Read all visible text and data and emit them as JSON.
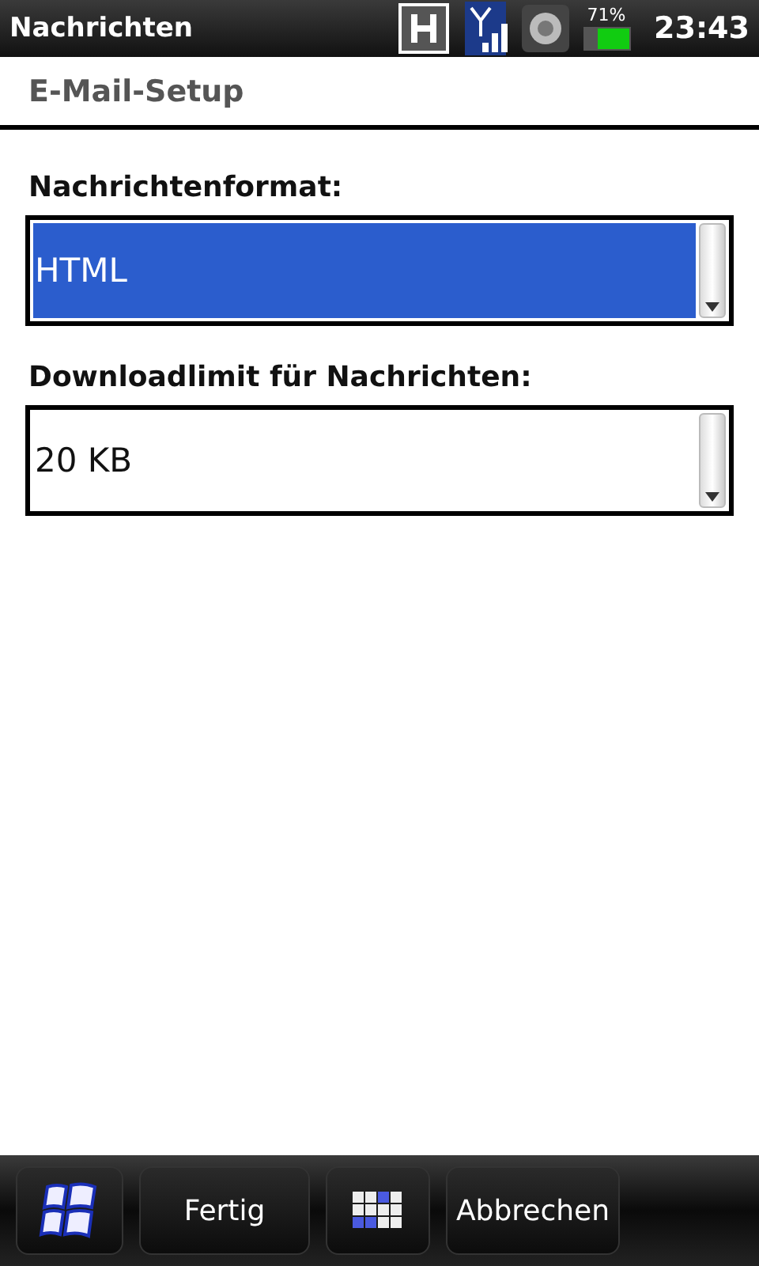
{
  "status_bar": {
    "app_title": "Nachrichten",
    "battery_percent": "71%",
    "time": "23:43"
  },
  "header": {
    "title": "E-Mail-Setup"
  },
  "fields": [
    {
      "label": "Nachrichtenformat:",
      "value": "HTML",
      "selected": true
    },
    {
      "label": "Downloadlimit für Nachrichten:",
      "value": "20 KB",
      "selected": false
    }
  ],
  "softkeys": [
    {
      "kind": "start"
    },
    {
      "kind": "text",
      "label": "Fertig"
    },
    {
      "kind": "keyboard"
    },
    {
      "kind": "text",
      "label": "Abbrechen"
    }
  ]
}
